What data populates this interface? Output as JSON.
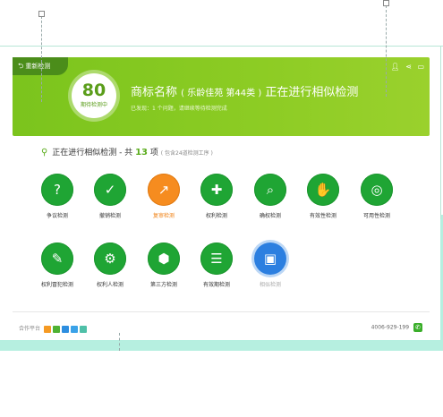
{
  "header": {
    "back_label": "重新检测",
    "score": "80",
    "score_label": "期待检测中",
    "title_main": "商标名称",
    "title_paren": "( 乐龄佳苑 第44类 )",
    "title_status": "正在进行相似检测",
    "subtitle": "已发现：1 个问题，请继续等待检测完成",
    "icons": [
      "user-icon",
      "share-icon",
      "message-icon"
    ]
  },
  "progress": {
    "prefix": "正在进行相似检测 - 共",
    "count": "13",
    "unit": "项",
    "note": "( 包含24道检测工序 )"
  },
  "tools": [
    {
      "name": "争议检测",
      "state": "done",
      "glyph": "?"
    },
    {
      "name": "撤销检测",
      "state": "done",
      "glyph": "✓"
    },
    {
      "name": "复审检测",
      "state": "active",
      "glyph": "↗"
    },
    {
      "name": "权利检测",
      "state": "done",
      "glyph": "✚"
    },
    {
      "name": "确权检测",
      "state": "done",
      "glyph": "⌕"
    },
    {
      "name": "有效性检测",
      "state": "done",
      "glyph": "✋"
    },
    {
      "name": "可用性检测",
      "state": "done",
      "glyph": "◎"
    },
    {
      "name": "权利冒犯检测",
      "state": "done",
      "glyph": "✎"
    },
    {
      "name": "权利人检测",
      "state": "done",
      "glyph": "⚙"
    },
    {
      "name": "第三方检测",
      "state": "done",
      "glyph": "⬢"
    },
    {
      "name": "有效期检测",
      "state": "done",
      "glyph": "☰"
    },
    {
      "name": "相似检测",
      "state": "pending",
      "glyph": "▣"
    }
  ],
  "footer": {
    "partners_label": "合作平台",
    "partner_colors": [
      "#f59a23",
      "#4fb233",
      "#2d8ee0",
      "#3aa2e8",
      "#4fc0a8"
    ],
    "phone": "4006-929-199"
  },
  "colors": {
    "brand_green": "#7bc41d",
    "done_green": "#1fa534",
    "active_orange": "#f68c1f",
    "pending_blue": "#2c7fe0"
  }
}
